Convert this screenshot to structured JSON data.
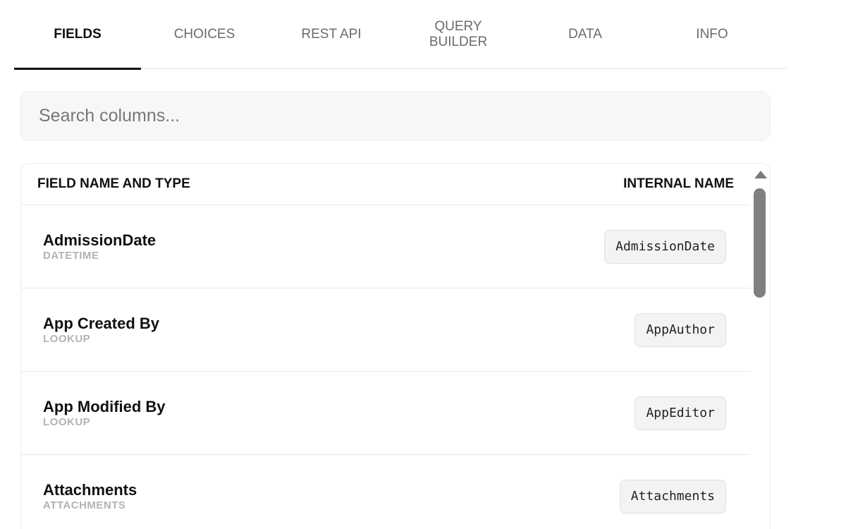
{
  "tabs": [
    {
      "label": "FIELDS",
      "active": true
    },
    {
      "label": "CHOICES",
      "active": false
    },
    {
      "label": "REST API",
      "active": false
    },
    {
      "label": "QUERY\nBUILDER",
      "active": false
    },
    {
      "label": "DATA",
      "active": false
    },
    {
      "label": "INFO",
      "active": false
    }
  ],
  "search": {
    "placeholder": "Search columns...",
    "value": ""
  },
  "table": {
    "headers": {
      "left": "FIELD NAME AND TYPE",
      "right": "INTERNAL NAME"
    },
    "rows": [
      {
        "name": "AdmissionDate",
        "type": "DATETIME",
        "internal": "AdmissionDate"
      },
      {
        "name": "App Created By",
        "type": "LOOKUP",
        "internal": "AppAuthor"
      },
      {
        "name": "App Modified By",
        "type": "LOOKUP",
        "internal": "AppEditor"
      },
      {
        "name": "Attachments",
        "type": "ATTACHMENTS",
        "internal": "Attachments"
      }
    ]
  },
  "icons": {
    "scroll_up": "triangle-up-icon"
  }
}
